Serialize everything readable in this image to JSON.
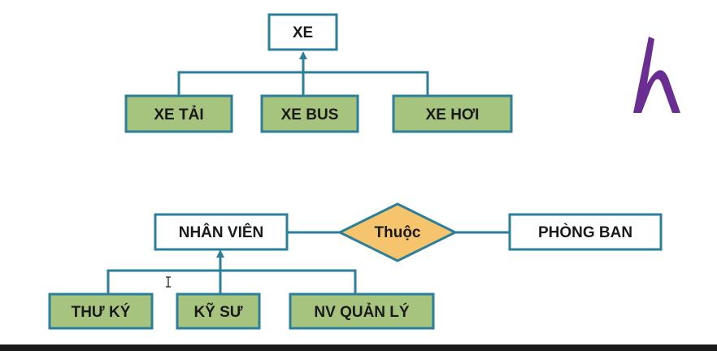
{
  "colors": {
    "connector": "#2b7f9b",
    "box_border": "#2b7f9b",
    "subtype_fill": "#a7c47f",
    "entity_fill": "#ffffff",
    "relationship_fill": "#f6c46c",
    "relationship_border": "#2b7f9b",
    "logo": "#6a2d91"
  },
  "top_diagram": {
    "parent": "XE",
    "children": [
      "XE TẢI",
      "XE BUS",
      "XE HƠI"
    ]
  },
  "bottom_diagram": {
    "parent": "NHÂN VIÊN",
    "relationship": "Thuộc",
    "related_entity": "PHÒNG BAN",
    "children": [
      "THƯ KÝ",
      "KỸ SƯ",
      "NV QUẢN LÝ"
    ]
  },
  "logo_icon": "h-letter-logo-icon",
  "cursor_icon": "text-cursor-icon"
}
